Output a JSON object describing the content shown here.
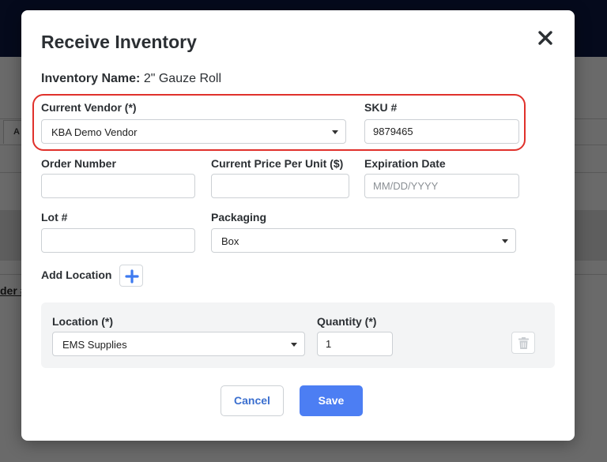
{
  "background": {
    "tab_label": "A",
    "order_link": "der #"
  },
  "modal": {
    "title": "Receive Inventory",
    "inventory_name_label": "Inventory Name:",
    "inventory_name_value": "2\" Gauze Roll"
  },
  "fields": {
    "current_vendor": {
      "label": "Current Vendor (*)",
      "value": "KBA Demo Vendor"
    },
    "sku": {
      "label": "SKU #",
      "value": "9879465"
    },
    "order_number": {
      "label": "Order Number",
      "value": ""
    },
    "price_per_unit": {
      "label": "Current Price Per Unit ($)",
      "value": ""
    },
    "expiration_date": {
      "label": "Expiration Date",
      "placeholder": "MM/DD/YYYY"
    },
    "lot": {
      "label": "Lot #",
      "value": ""
    },
    "packaging": {
      "label": "Packaging",
      "value": "Box"
    }
  },
  "add_location": {
    "label": "Add Location"
  },
  "location_row": {
    "location_label": "Location (*)",
    "location_value": "EMS Supplies",
    "quantity_label": "Quantity (*)",
    "quantity_value": "1"
  },
  "actions": {
    "cancel_label": "Cancel",
    "save_label": "Save"
  },
  "colors": {
    "primary": "#4c7ef3",
    "highlight_ring": "#e0312b",
    "top_bar": "#050a1c"
  }
}
